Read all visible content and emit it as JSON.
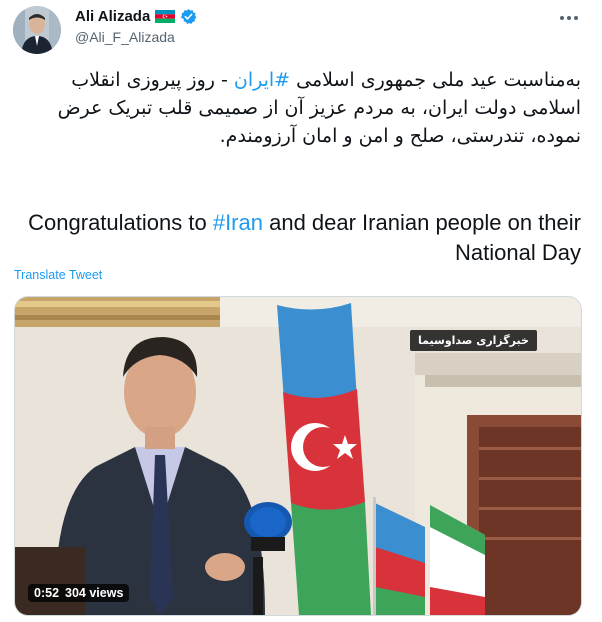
{
  "user": {
    "display_name": "Ali Alizada",
    "handle": "@Ali_F_Alizada"
  },
  "icons": {
    "flag": "azerbaijan-flag-icon",
    "verified": "verified-badge-icon",
    "more": "more-options-icon"
  },
  "tweet": {
    "fa_before": "به‌مناسبت عید ملی جمهوری اسلامی ",
    "fa_hashtag": "#ایران",
    "fa_after": " - روز پیروزی انقلاب اسلامی دولت ایران، به مردم عزیز  آن از صمیمی قلب تبریک عرض  نموده، تندرستی، صلح و امن و امان آرزومندم.",
    "en_before": "Congratulations to ",
    "en_hashtag": "#Iran",
    "en_after": " and dear Iranian people on their National Day"
  },
  "translate_label": "Translate Tweet",
  "media": {
    "watermark": "خبرگزاری صداوسیما",
    "duration": "0:52",
    "views": "304 views"
  },
  "colors": {
    "link": "#1d9bf0",
    "text": "#0f1419",
    "muted": "#536471"
  }
}
